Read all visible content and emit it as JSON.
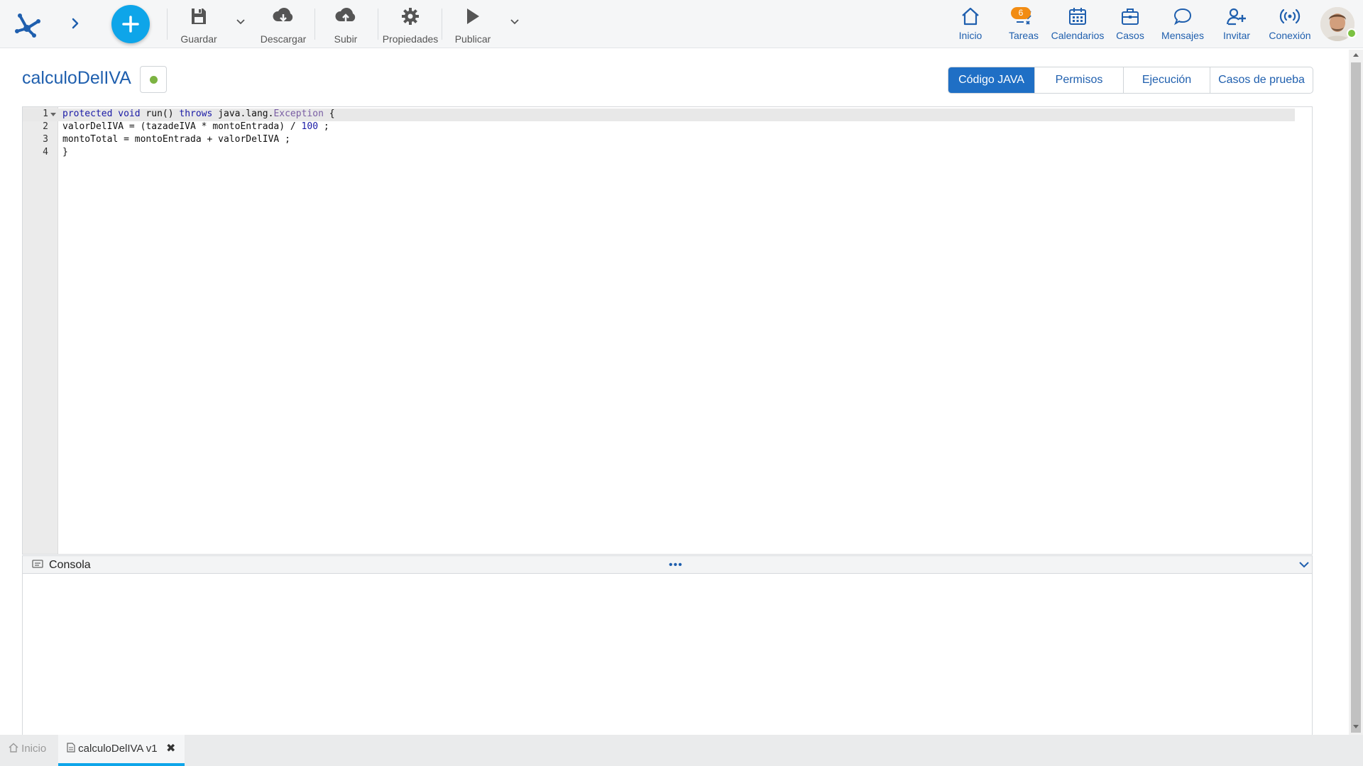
{
  "toolbar": {
    "save": "Guardar",
    "download": "Descargar",
    "upload": "Subir",
    "properties": "Propiedades",
    "publish": "Publicar"
  },
  "nav": {
    "home": "Inicio",
    "tasks": "Tareas",
    "tasks_badge": "6",
    "calendars": "Calendarios",
    "cases": "Casos",
    "messages": "Mensajes",
    "invite": "Invitar",
    "connection": "Conexión"
  },
  "header": {
    "title": "calculoDelIVA",
    "status_color": "#7cb342"
  },
  "tabs": {
    "java": "Código JAVA",
    "permissions": "Permisos",
    "execution": "Ejecución",
    "test_cases": "Casos de prueba",
    "active": "Código JAVA"
  },
  "editor": {
    "line_numbers": [
      "1",
      "2",
      "3",
      "4"
    ],
    "lines": {
      "l1": {
        "kw1": "protected",
        "kw2": "void",
        "plain1": " run() ",
        "kw3": "throws",
        "plain2": " java.lang.",
        "cls": "Exception",
        "plain3": " {"
      },
      "l2": {
        "plain1": "valorDelIVA = (tazadeIVA * montoEntrada) / ",
        "num": "100",
        "plain2": " ;"
      },
      "l3": {
        "plain1": "montoTotal = montoEntrada + valorDelIVA ;"
      },
      "l4": {
        "plain1": "}"
      }
    }
  },
  "console": {
    "label": "Consola",
    "drag_handle": "•••"
  },
  "bottom_tabs": {
    "home": "Inicio",
    "doc": "calculoDelIVA v1",
    "close": "✖"
  },
  "colors": {
    "accent": "#1f5fae",
    "fab": "#0ea5e9",
    "badge": "#f28c13",
    "active_tab": "#1f6fc5"
  }
}
